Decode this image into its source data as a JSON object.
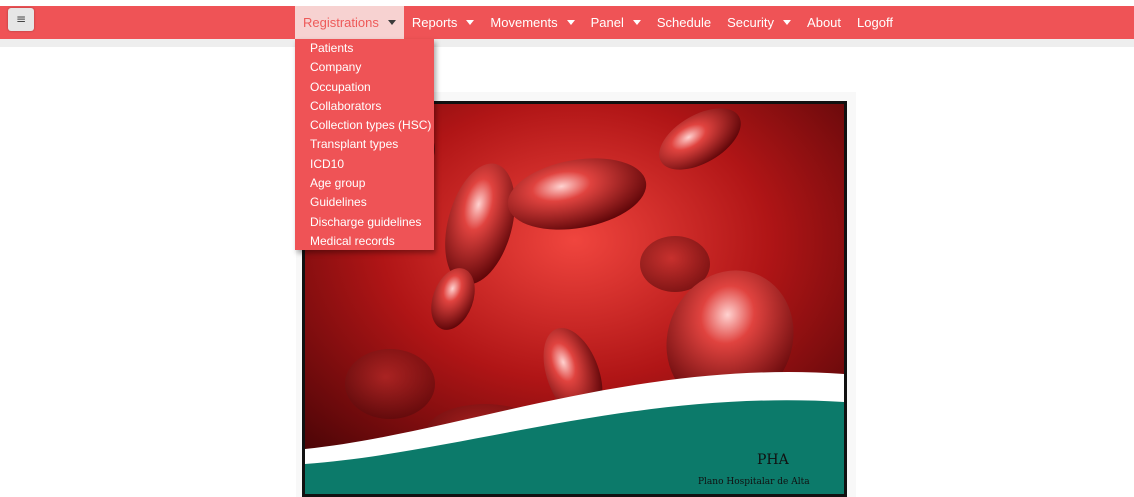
{
  "toggle": {
    "icon": "≡"
  },
  "nav": {
    "items": [
      {
        "label": "Registrations",
        "has_caret": true,
        "active": true
      },
      {
        "label": "Reports",
        "has_caret": true
      },
      {
        "label": "Movements",
        "has_caret": true
      },
      {
        "label": "Panel",
        "has_caret": true
      },
      {
        "label": "Schedule",
        "has_caret": false
      },
      {
        "label": "Security",
        "has_caret": true
      },
      {
        "label": "About",
        "has_caret": false
      },
      {
        "label": "Logoff",
        "has_caret": false
      }
    ]
  },
  "dropdown": {
    "items": [
      "Patients",
      "Company",
      "Occupation",
      "Collaborators",
      "Collection types (HSC)",
      "Transplant types",
      "ICD10",
      "Age group",
      "Guidelines",
      "Discharge guidelines",
      "Medical records"
    ]
  },
  "banner": {
    "abbr": "PHA",
    "full": "Plano Hospitalar de Alta"
  },
  "colors": {
    "navbar": "#ef5356",
    "active_tab_bg": "#f7d2d1",
    "banner_teal": "#0c7a6a"
  }
}
